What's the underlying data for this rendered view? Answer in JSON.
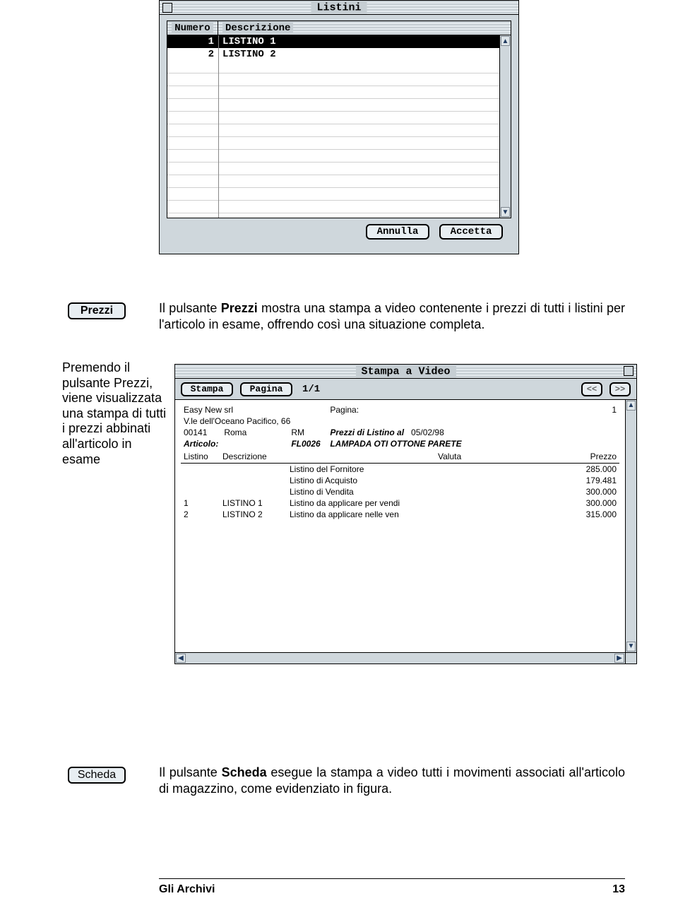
{
  "listini_window": {
    "title": "Listini",
    "columns": {
      "numero": "Numero",
      "descrizione": "Descrizione"
    },
    "rows": [
      {
        "num": "1",
        "desc": "LISTINO 1",
        "selected": true
      },
      {
        "num": "2",
        "desc": "LISTINO 2",
        "selected": false
      }
    ],
    "buttons": {
      "annulla": "Annulla",
      "accetta": "Accetta"
    }
  },
  "prezzi_button": "Prezzi",
  "prezzi_paragraph_before": "Il pulsante ",
  "prezzi_paragraph_bold": "Prezzi",
  "prezzi_paragraph_after": " mostra una stampa a video contenente i prezzi di tutti i listini per l'articolo in esame, offrendo così una situazione completa.",
  "side_caption": "Premendo il pulsante Prezzi, viene visualizzata una stampa di tutti i prezzi abbinati all'articolo in esame",
  "stampa_window": {
    "title": "Stampa a Video",
    "toolbar": {
      "stampa": "Stampa",
      "pagina": "Pagina",
      "indicator": "1/1",
      "prev": "<<",
      "next": ">>"
    },
    "report": {
      "company": "Easy New srl",
      "pagina_label": "Pagina:",
      "pagina_val": "1",
      "address1": "V.le dell'Oceano Pacifico, 66",
      "cap": "00141",
      "city": "Roma",
      "prov": "RM",
      "heading": "Prezzi di Listino al",
      "date": "05/02/98",
      "articolo_label": "Articolo:",
      "articolo_code": "FL0026",
      "articolo_desc": "LAMPADA OTI OTTONE PARETE",
      "th": {
        "listino": "Listino",
        "descrizione": "Descrizione",
        "valuta": "Valuta",
        "prezzo": "Prezzo"
      },
      "rows": [
        {
          "listino": "",
          "codice": "",
          "descr": "Listino del Fornitore",
          "valuta": "",
          "prezzo": "285.000"
        },
        {
          "listino": "",
          "codice": "",
          "descr": "Listino di Acquisto",
          "valuta": "",
          "prezzo": "179.481"
        },
        {
          "listino": "",
          "codice": "",
          "descr": "Listino di Vendita",
          "valuta": "",
          "prezzo": "300.000"
        },
        {
          "listino": "1",
          "codice": "LISTINO 1",
          "descr": "Listino da applicare per vendi",
          "valuta": "",
          "prezzo": "300.000"
        },
        {
          "listino": "2",
          "codice": "LISTINO 2",
          "descr": "Listino da applicare nelle ven",
          "valuta": "",
          "prezzo": "315.000"
        }
      ]
    }
  },
  "scheda_button": "Scheda",
  "scheda_paragraph_before": "Il pulsante ",
  "scheda_paragraph_bold": "Scheda",
  "scheda_paragraph_after": " esegue la stampa a video tutti i movimenti associati all'articolo di magazzino, come evidenziato in figura.",
  "footer": {
    "title": "Gli Archivi",
    "page": "13"
  }
}
